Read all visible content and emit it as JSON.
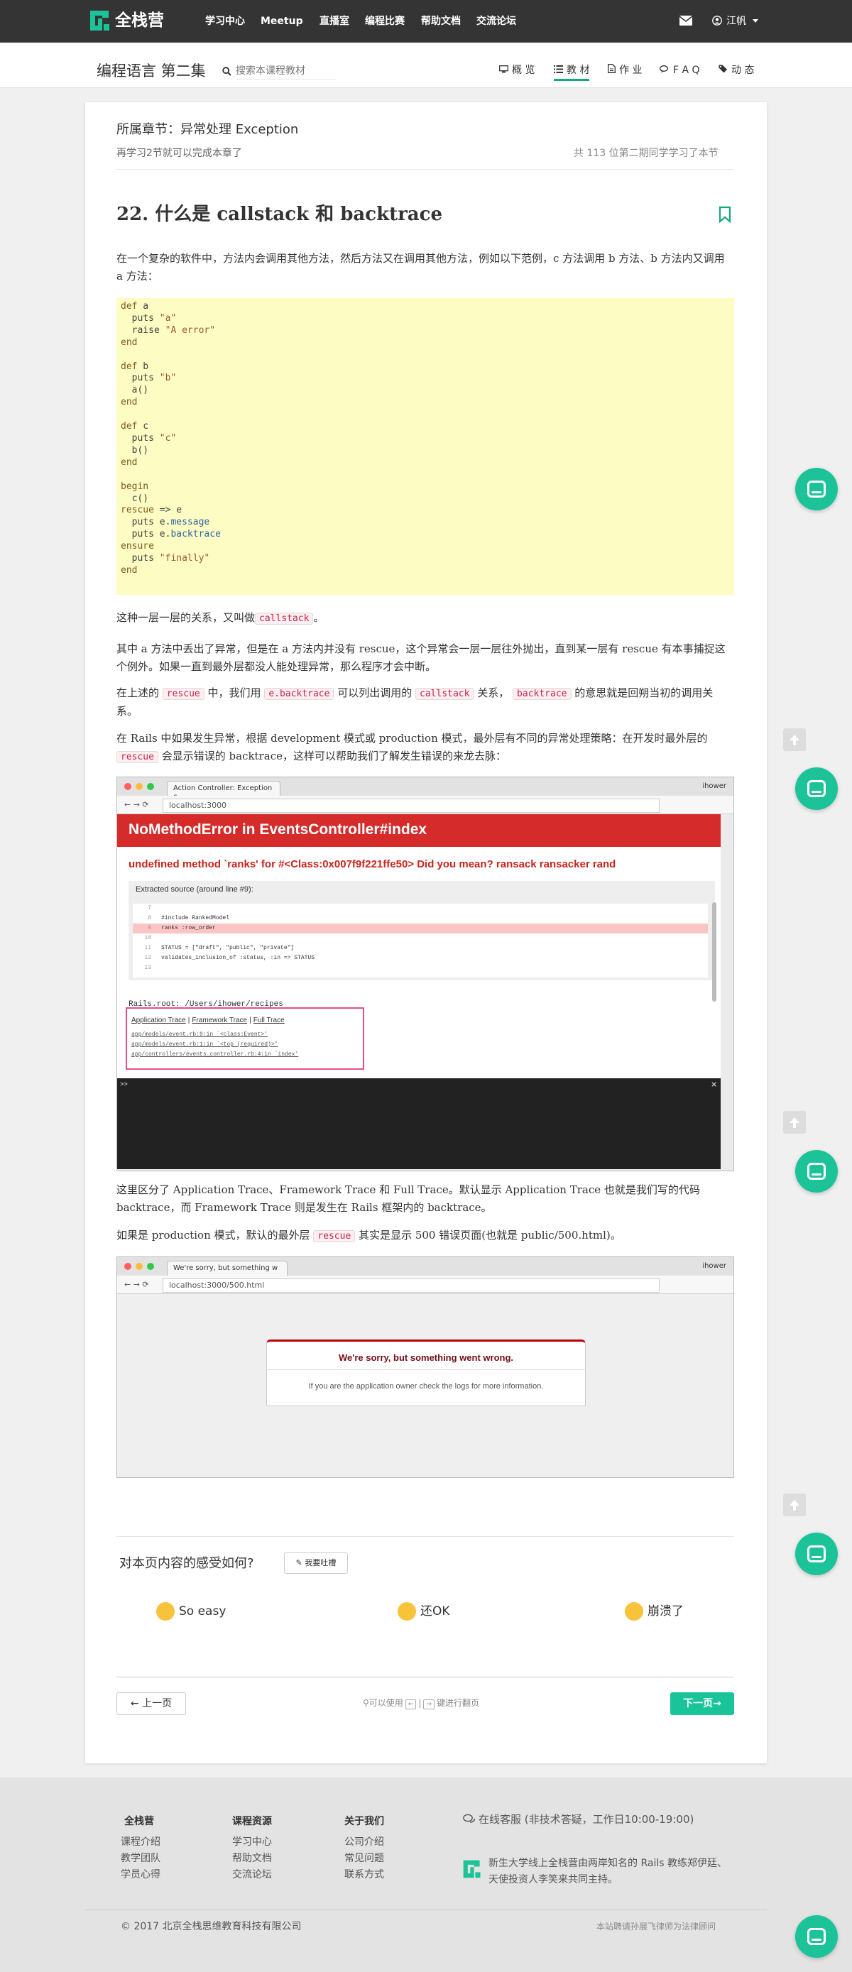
{
  "brand": {
    "name": "全栈营",
    "accent": "#16a881"
  },
  "topnav": {
    "items": [
      "学习中心",
      "Meetup",
      "直播室",
      "编程比赛",
      "帮助文档",
      "交流论坛"
    ],
    "user_name": "江帆"
  },
  "subnav": {
    "course_title": "编程语言 第二集",
    "search_placeholder": "搜索本课程教材",
    "tabs": [
      {
        "label": "概 览",
        "icon": "desktop-icon"
      },
      {
        "label": "教 材",
        "icon": "list-icon",
        "active": true
      },
      {
        "label": "作 业",
        "icon": "file-icon"
      },
      {
        "label": "F A Q",
        "icon": "comments-icon"
      },
      {
        "label": "动 态",
        "icon": "tags-icon"
      }
    ]
  },
  "lesson": {
    "chapter": "所属章节：异常处理 Exception",
    "progress_note": "再学习2节就可以完成本章了",
    "readers_note": "共 113 位第二期同学学习了本节",
    "title": "22. 什么是 callstack 和 backtrace",
    "intro": "在一个复杂的软件中，方法内会调用其他方法，然后方法又在调用其他方法，例如以下范例，c 方法调用 b 方法、b 方法内又调用 a 方法：",
    "p1_text": "这种一层一层的关系，又叫做",
    "p1_code": "callstack",
    "p1_end": "。",
    "p2": "其中 a 方法中丢出了异常，但是在 a 方法内并没有 rescue，这个异常会一层一层往外抛出，直到某一层有 rescue 有本事捕捉这个例外。如果一直到最外层都没人能处理异常，那么程序才会中断。",
    "p3_a": "在上述的",
    "p3_c1": "rescue",
    "p3_b": "中，我们用",
    "p3_c2": "e.backtrace",
    "p3_c": "可以列出调用的",
    "p3_c3": "callstack",
    "p3_d": "关系，",
    "p3_c4": "backtrace",
    "p3_e": "的意思就是回朔当初的调用关系。",
    "p4_a": "在 Rails 中如果发生异常，根据 development 模式或 production 模式，最外层有不同的异常处理策略：在开发时最外层的",
    "p4_c1": "rescue",
    "p4_b": "会显示错误的 backtrace，这样可以帮助我们了解发生错误的来龙去脉：",
    "p5": "这里区分了 Application Trace、Framework Trace 和 Full Trace。默认显示 Application Trace 也就是我们写的代码 backtrace，而 Framework Trace 则是发生在 Rails 框架内的 backtrace。",
    "p6_a": "如果是 production 模式，默认的最外层",
    "p6_c1": "rescue",
    "p6_b": "其实是显示 500 错误页面(也就是 public/500.html)。"
  },
  "code_lines": [
    "def a",
    "  puts \"a\"",
    "  raise \"A error\"",
    "end",
    "",
    "def b",
    "  puts \"b\"",
    "  a()",
    "end",
    "",
    "def c",
    "  puts \"c\"",
    "  b()",
    "end",
    "",
    "begin",
    "  c()",
    "rescue => e",
    "  puts e.message",
    "  puts e.backtrace",
    "ensure",
    "  puts \"finally\"",
    "end"
  ],
  "shot1": {
    "tab_title": "Action Controller: Exception c",
    "browser_user": "ihower",
    "url": "localhost:3000",
    "error_title": "NoMethodError in EventsController#index",
    "error_message": "undefined method `ranks' for #<Class:0x007f9f221ffe50> Did you mean? ransack ransacker rand",
    "extracted_label": "Extracted source (around line #9):",
    "source_lines": [
      {
        "no": "7",
        "code": ""
      },
      {
        "no": "8",
        "code": "#include RankedModel"
      },
      {
        "no": "9",
        "code": "ranks :row_order",
        "highlight": true
      },
      {
        "no": "10",
        "code": ""
      },
      {
        "no": "11",
        "code": "STATUS = [\"draft\", \"public\", \"private\"]"
      },
      {
        "no": "12",
        "code": "validates_inclusion_of :status, :in => STATUS"
      },
      {
        "no": "13",
        "code": ""
      }
    ],
    "rails_root": "Rails.root: /Users/ihower/recipes",
    "trace_tabs": [
      "Application Trace",
      "|",
      "Framework Trace",
      "|",
      "Full Trace"
    ],
    "trace_lines": [
      "app/models/event.rb:9:in `<class:Event>'",
      "app/models/event.rb:1:in `<top (required)>'",
      "app/controllers/events_controller.rb:4:in `index'"
    ],
    "console_prompt": ">>",
    "console_close": "×"
  },
  "shot2": {
    "tab_title": "We're sorry, but something w",
    "browser_user": "ihower",
    "url": "localhost:3000/500.html",
    "heading": "We're sorry, but something went wrong.",
    "body": "If you are the application owner check the logs for more information."
  },
  "feedback": {
    "question": "对本页内容的感受如何?",
    "button": "我要吐槽",
    "reactions": [
      "So easy",
      "还OK",
      "崩溃了"
    ]
  },
  "pager": {
    "prev": "上一页",
    "next": "下一页",
    "hint_a": "可以使用",
    "key_left": "←",
    "key_right": "→",
    "hint_b": "键进行翻页"
  },
  "footer": {
    "cols": [
      {
        "title": "全栈营",
        "links": [
          "课程介绍",
          "教学团队",
          "学员心得"
        ]
      },
      {
        "title": "课程资源",
        "links": [
          "学习中心",
          "帮助文档",
          "交流论坛"
        ]
      },
      {
        "title": "关于我们",
        "links": [
          "公司介绍",
          "常见问题",
          "联系方式"
        ]
      }
    ],
    "service": "在线客服 (非技术答疑，工作日10:00-19:00)",
    "about": "新生大学线上全栈营由两岸知名的 Rails 教练郑伊廷、天使投资人李笑来共同主持。",
    "copyright": "© 2017 北京全栈思维教育科技有限公司",
    "legal": "本站聘请孙展飞律师为法律顾问"
  }
}
